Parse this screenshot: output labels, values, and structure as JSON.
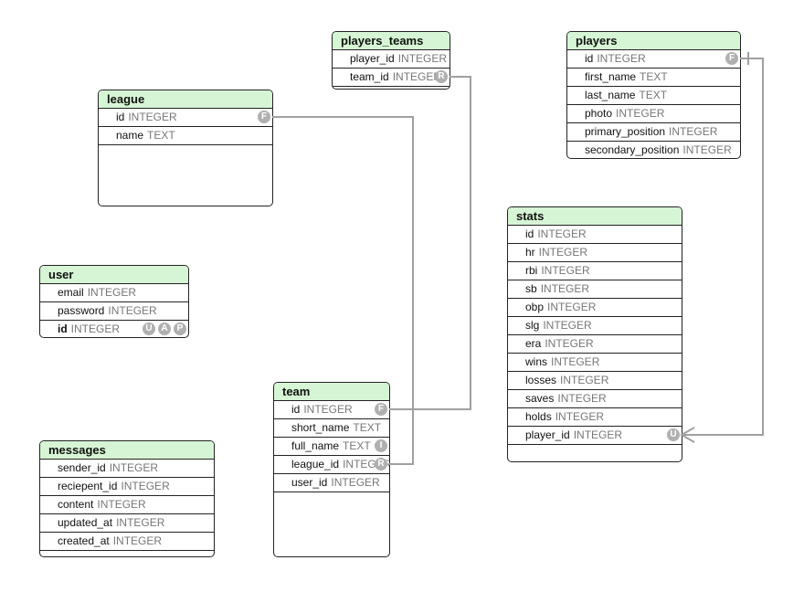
{
  "tables": [
    {
      "name": "players_teams",
      "columns": [
        {
          "name": "player_id",
          "type": "INTEGER",
          "badges": []
        },
        {
          "name": "team_id",
          "type": "INTEGER",
          "badges": [
            "R"
          ]
        }
      ]
    },
    {
      "name": "players",
      "columns": [
        {
          "name": "id",
          "type": "INTEGER",
          "badges": [
            "F"
          ]
        },
        {
          "name": "first_name",
          "type": "TEXT",
          "badges": []
        },
        {
          "name": "last_name",
          "type": "TEXT",
          "badges": []
        },
        {
          "name": "photo",
          "type": "INTEGER",
          "badges": []
        },
        {
          "name": "primary_position",
          "type": "INTEGER",
          "badges": []
        },
        {
          "name": "secondary_position",
          "type": "INTEGER",
          "badges": []
        }
      ]
    },
    {
      "name": "league",
      "columns": [
        {
          "name": "id",
          "type": "INTEGER",
          "badges": [
            "F"
          ]
        },
        {
          "name": "name",
          "type": "TEXT",
          "badges": []
        }
      ]
    },
    {
      "name": "stats",
      "columns": [
        {
          "name": "id",
          "type": "INTEGER",
          "badges": []
        },
        {
          "name": "hr",
          "type": "INTEGER",
          "badges": []
        },
        {
          "name": "rbi",
          "type": "INTEGER",
          "badges": []
        },
        {
          "name": "sb",
          "type": "INTEGER",
          "badges": []
        },
        {
          "name": "obp",
          "type": "INTEGER",
          "badges": []
        },
        {
          "name": "slg",
          "type": "INTEGER",
          "badges": []
        },
        {
          "name": "era",
          "type": "INTEGER",
          "badges": []
        },
        {
          "name": "wins",
          "type": "INTEGER",
          "badges": []
        },
        {
          "name": "losses",
          "type": "INTEGER",
          "badges": []
        },
        {
          "name": "saves",
          "type": "INTEGER",
          "badges": []
        },
        {
          "name": "holds",
          "type": "INTEGER",
          "badges": []
        },
        {
          "name": "player_id",
          "type": "INTEGER",
          "badges": [
            "U"
          ]
        }
      ]
    },
    {
      "name": "user",
      "columns": [
        {
          "name": "email",
          "type": "INTEGER",
          "badges": []
        },
        {
          "name": "password",
          "type": "INTEGER",
          "badges": []
        },
        {
          "name": "id",
          "type": "INTEGER",
          "badges": [
            "U",
            "A",
            "P"
          ],
          "primary": true
        }
      ]
    },
    {
      "name": "team",
      "columns": [
        {
          "name": "id",
          "type": "INTEGER",
          "badges": [
            "F"
          ]
        },
        {
          "name": "short_name",
          "type": "TEXT",
          "badges": []
        },
        {
          "name": "full_name",
          "type": "TEXT",
          "badges": [
            "I"
          ]
        },
        {
          "name": "league_id",
          "type": "INTEGER",
          "badges": [
            "R"
          ]
        },
        {
          "name": "user_id",
          "type": "INTEGER",
          "badges": []
        }
      ]
    },
    {
      "name": "messages",
      "columns": [
        {
          "name": "sender_id",
          "type": "INTEGER",
          "badges": []
        },
        {
          "name": "reciepent_id",
          "type": "INTEGER",
          "badges": []
        },
        {
          "name": "content",
          "type": "INTEGER",
          "badges": []
        },
        {
          "name": "updated_at",
          "type": "INTEGER",
          "badges": []
        },
        {
          "name": "created_at",
          "type": "INTEGER",
          "badges": []
        }
      ]
    }
  ],
  "relationships": [
    {
      "from": "league.id",
      "to": "team.league_id"
    },
    {
      "from": "team.id",
      "to": "players_teams.team_id"
    },
    {
      "from": "players.id",
      "to": "stats.player_id",
      "end": "many"
    }
  ],
  "colors": {
    "header": "#d6f5d4",
    "border": "#222222",
    "link": "#a0a0a0",
    "badge": "#b0b0b0"
  }
}
